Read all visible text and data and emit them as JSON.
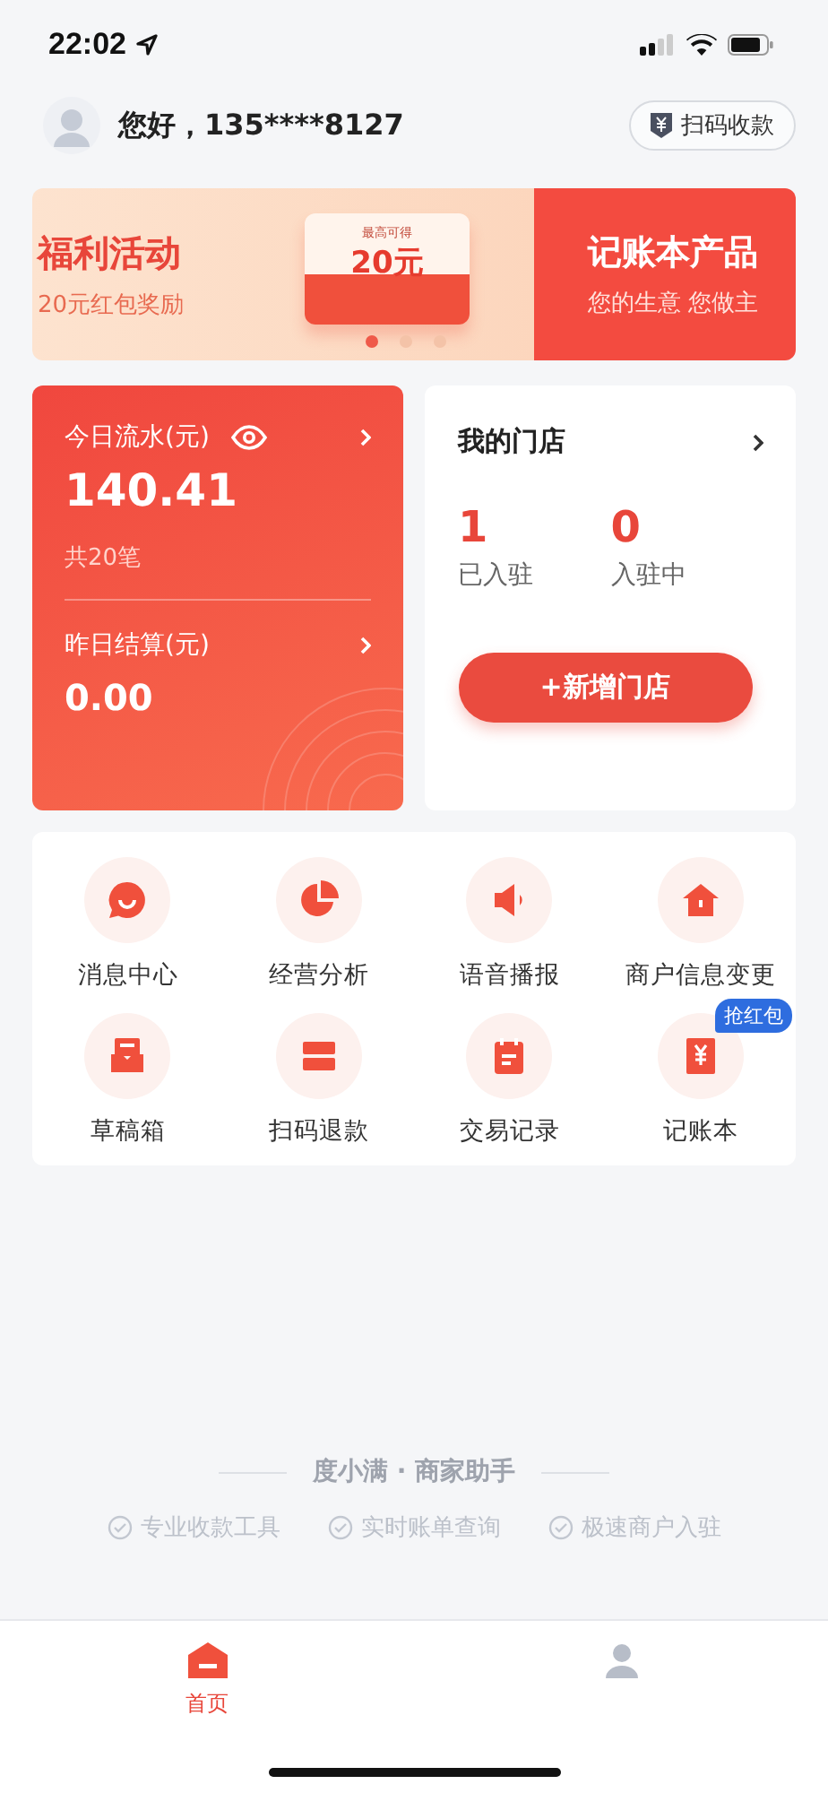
{
  "status_bar": {
    "time": "22:02"
  },
  "header": {
    "greeting": "您好，135****8127",
    "scan_button": "扫码收款"
  },
  "banner": {
    "slides": [
      {
        "title": "福利活动",
        "subtitle": "20元红包奖励",
        "badge_caption": "最高可得",
        "badge_amount": "20元"
      },
      {
        "title": "记账本产品",
        "subtitle": "您的生意 您做主"
      }
    ],
    "dots": [
      {
        "selected": true
      },
      {
        "selected": false
      },
      {
        "selected": false
      }
    ]
  },
  "revenue_card": {
    "today_label": "今日流水(元)",
    "today_amount": "140.41",
    "count": "共20笔",
    "yesterday_label": "昨日结算(元)",
    "yesterday_amount": "0.00"
  },
  "store_card": {
    "title": "我的门店",
    "stats": [
      {
        "value": "1",
        "label": "已入驻"
      },
      {
        "value": "0",
        "label": "入驻中"
      }
    ],
    "add_button": "+新增门店"
  },
  "shortcuts": [
    {
      "kind": "chat",
      "label": "消息中心"
    },
    {
      "kind": "pie",
      "label": "经营分析"
    },
    {
      "kind": "speaker",
      "label": "语音播报"
    },
    {
      "kind": "house",
      "label": "商户信息变更"
    },
    {
      "kind": "inbox",
      "label": "草稿箱"
    },
    {
      "kind": "card",
      "label": "扫码退款"
    },
    {
      "kind": "calendar",
      "label": "交易记录"
    },
    {
      "kind": "ledger",
      "label": "记账本",
      "badge": "抢红包"
    }
  ],
  "footer": {
    "brand": "度小满 · 商家助手",
    "features": [
      "专业收款工具",
      "实时账单查询",
      "极速商户入驻"
    ]
  },
  "tab_bar": [
    {
      "kind": "home",
      "label": "首页",
      "selected": true
    },
    {
      "kind": "person",
      "selected": false
    }
  ]
}
